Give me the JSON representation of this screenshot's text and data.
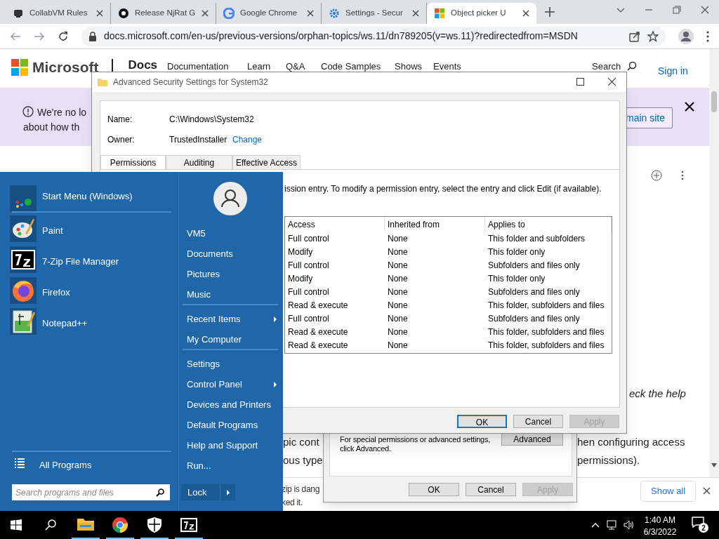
{
  "browser": {
    "tabs": [
      {
        "title": "CollabVM Rules",
        "selected": false
      },
      {
        "title": "Release NjRat G",
        "selected": false
      },
      {
        "title": "Google Chrome",
        "selected": false
      },
      {
        "title": "Settings - Secur",
        "selected": false
      },
      {
        "title": "Object picker U",
        "selected": true
      }
    ],
    "url": "docs.microsoft.com/en-us/previous-versions/orphan-topics/ws.11/dn789205(v=ws.11)?redirectedfrom=MSDN"
  },
  "docs_header": {
    "brand": "Microsoft",
    "section": "Docs",
    "nav": [
      "Documentation",
      "Learn",
      "Q&A",
      "Code Samples",
      "Shows",
      "Events"
    ],
    "search": "Search",
    "sign_in": "Sign in"
  },
  "banner": {
    "lines": [
      "We're no lo",
      "about how th"
    ],
    "button": "main site"
  },
  "article": {
    "fragments": [
      "eck the help",
      "pic cont",
      "hen configuring access",
      "ous type",
      "permissions)."
    ]
  },
  "download_bar": {
    "lines": [
      "zip is dang",
      "ked it."
    ],
    "show_all": "Show all"
  },
  "basic_dialog": {
    "note_lines": [
      "For special permissions or advanced settings,",
      "click Advanced."
    ],
    "advanced_button": "Advanced",
    "buttons": [
      {
        "label": "OK",
        "default": false,
        "disabled": false
      },
      {
        "label": "Cancel",
        "default": false,
        "disabled": false
      },
      {
        "label": "Apply",
        "default": false,
        "disabled": true
      }
    ]
  },
  "advanced_dialog": {
    "title": "Advanced Security Settings for System32",
    "name_label": "Name:",
    "name_value": "C:\\Windows\\System32",
    "owner_label": "Owner:",
    "owner_value": "TrustedInstaller",
    "change_link": "Change",
    "tabs": [
      {
        "label": "Permissions",
        "selected": true
      },
      {
        "label": "Auditing",
        "selected": false
      },
      {
        "label": "Effective Access",
        "selected": false
      }
    ],
    "instructions": "ission entry. To modify a permission entry, select the entry and click Edit (if available).",
    "table": {
      "columns": [
        "Access",
        "Inherited from",
        "Applies to"
      ],
      "rows": [
        [
          "Full control",
          "None",
          "This folder and subfolders"
        ],
        [
          "Modify",
          "None",
          "This folder only"
        ],
        [
          "Full control",
          "None",
          "Subfolders and files only"
        ],
        [
          "Modify",
          "None",
          "This folder only"
        ],
        [
          "Full control",
          "None",
          "Subfolders and files only"
        ],
        [
          "Read & execute",
          "None",
          "This folder, subfolders and files"
        ],
        [
          "Full control",
          "None",
          "Subfolders and files only"
        ],
        [
          "Read & execute",
          "None",
          "This folder, subfolders and files"
        ],
        [
          "Read & execute",
          "None",
          "This folder, subfolders and files"
        ]
      ]
    },
    "buttons": [
      {
        "label": "OK",
        "default": true,
        "disabled": false
      },
      {
        "label": "Cancel",
        "default": false,
        "disabled": false
      },
      {
        "label": "Apply",
        "default": false,
        "disabled": true
      }
    ]
  },
  "start_menu": {
    "header_item": "Start Menu (Windows)",
    "programs": [
      "Paint",
      "7-Zip File Manager",
      "Firefox",
      "Notepad++"
    ],
    "all_programs": "All Programs",
    "search": {
      "placeholder": "Search programs and files"
    },
    "groups": [
      {
        "items": [
          {
            "label": "VM5",
            "submenu": false
          },
          {
            "label": "Documents",
            "submenu": false
          },
          {
            "label": "Pictures",
            "submenu": false
          },
          {
            "label": "Music",
            "submenu": false
          }
        ]
      },
      {
        "items": [
          {
            "label": "Recent Items",
            "submenu": true
          },
          {
            "label": "My Computer",
            "submenu": false
          }
        ]
      },
      {
        "items": [
          {
            "label": "Settings",
            "submenu": false
          },
          {
            "label": "Control Panel",
            "submenu": true
          },
          {
            "label": "Devices and Printers",
            "submenu": false
          },
          {
            "label": "Default Programs",
            "submenu": false
          },
          {
            "label": "Help and Support",
            "submenu": false
          },
          {
            "label": "Run...",
            "submenu": false
          }
        ]
      }
    ],
    "lock": "Lock"
  },
  "taskbar": {
    "apps": [
      {
        "running": true
      },
      {
        "running": true
      },
      {
        "running": true
      },
      {
        "running": true
      }
    ],
    "time": "1:40 AM",
    "date": "6/3/2022",
    "notification_count": "2"
  }
}
